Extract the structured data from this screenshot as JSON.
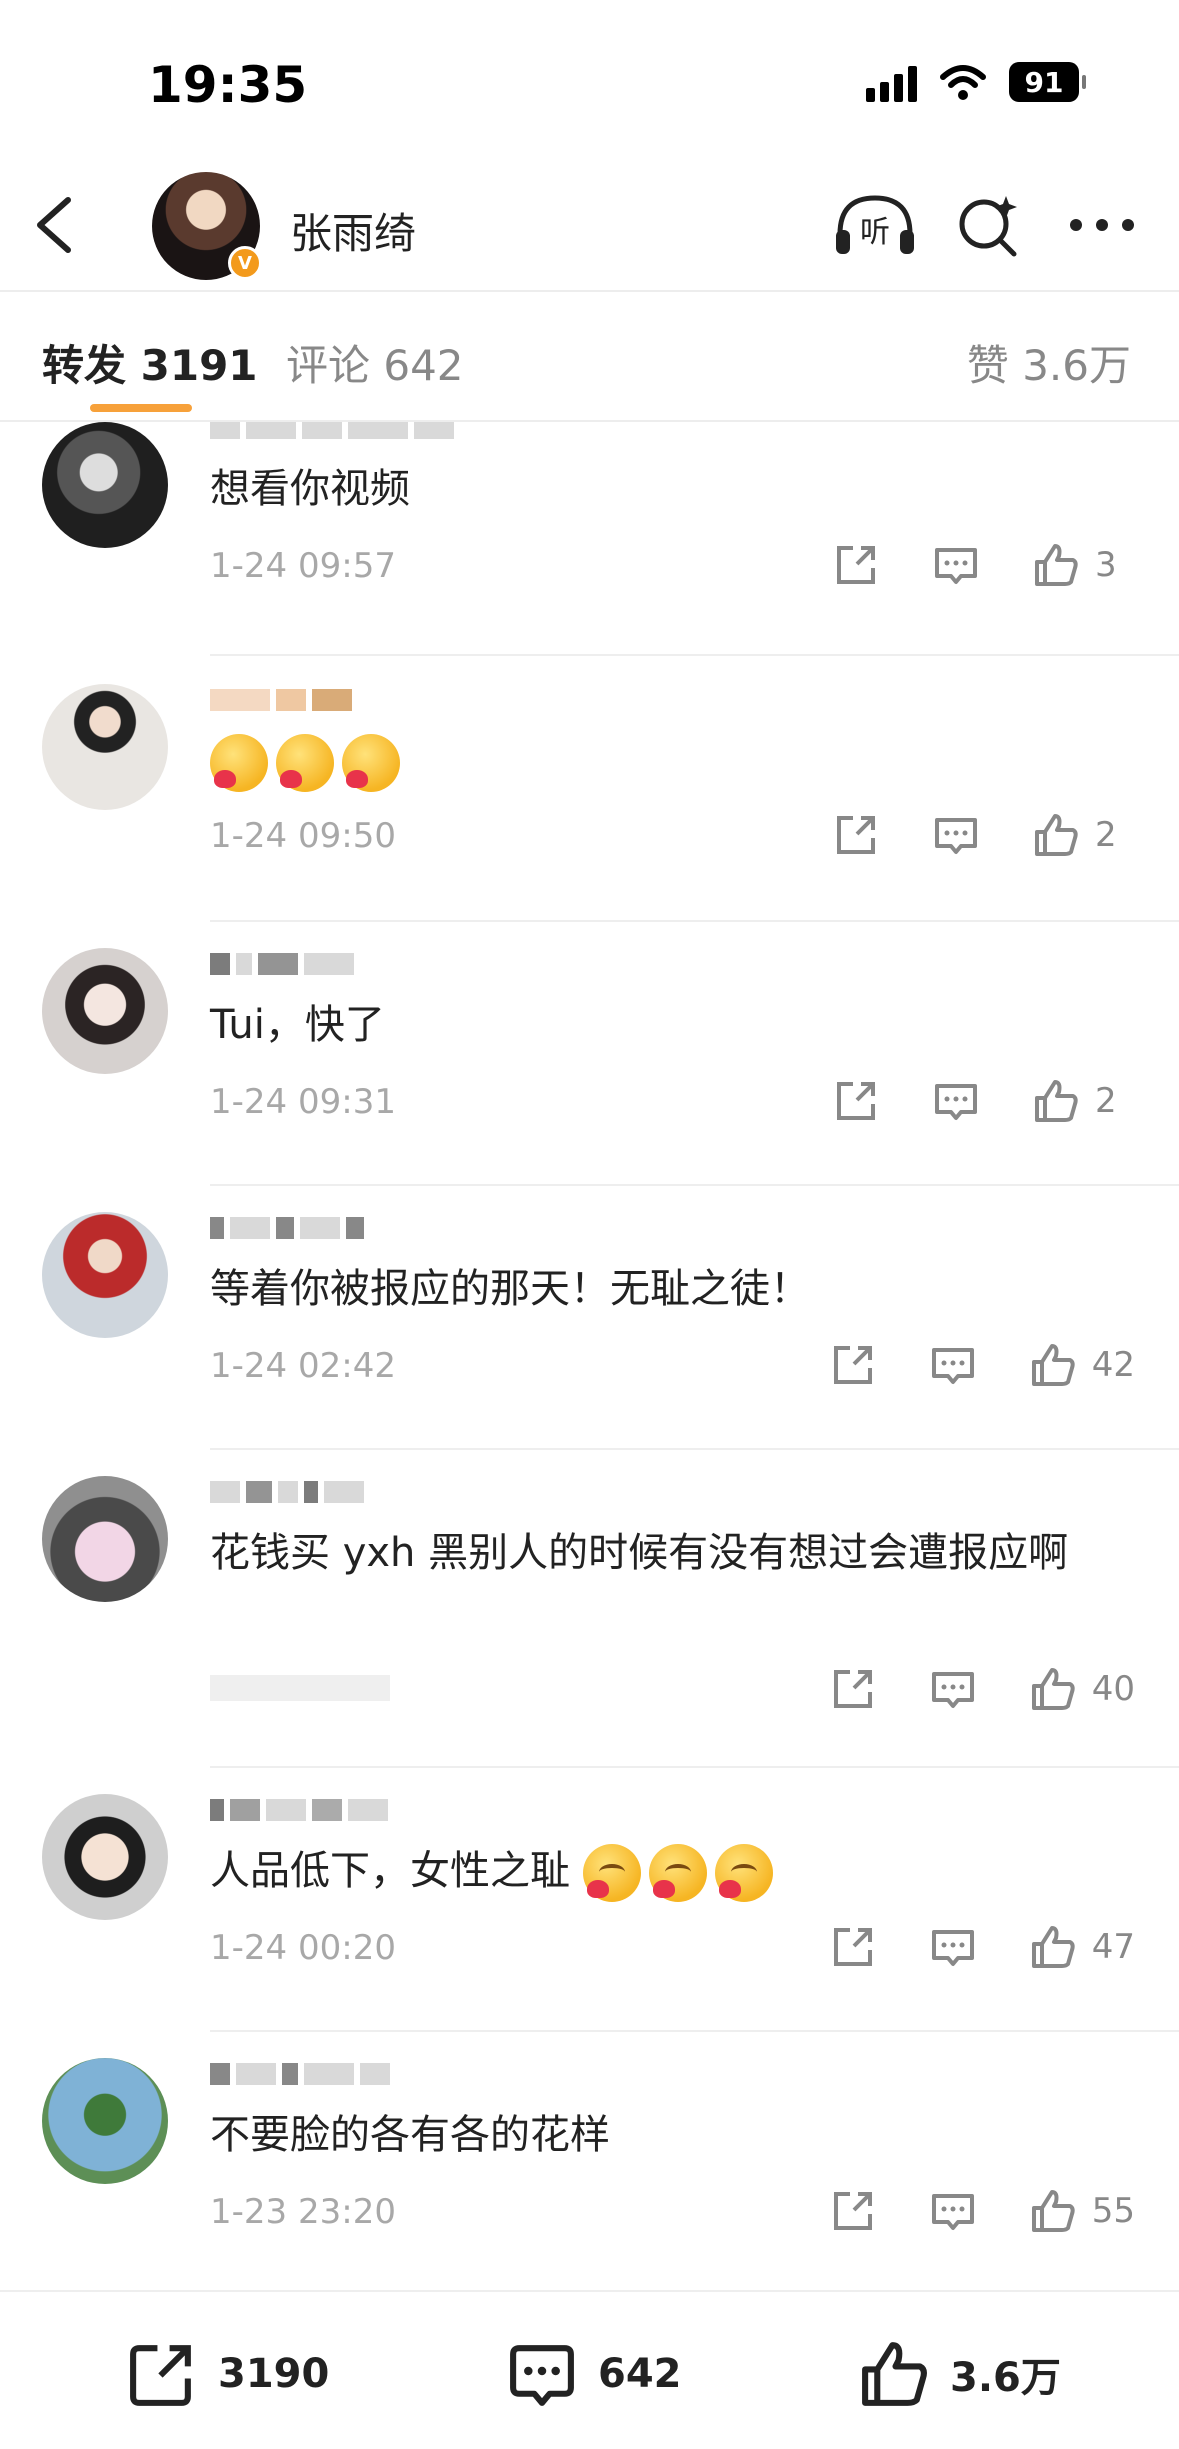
{
  "status_bar": {
    "time": "19:35",
    "battery": "91"
  },
  "header": {
    "name": "张雨绮"
  },
  "tabs": {
    "repost": "转发 3191",
    "comments": "评论 642",
    "likes": "赞 3.6万"
  },
  "comments": [
    {
      "text": "想看你视频",
      "time": "1-24 09:57",
      "likes": "3"
    },
    {
      "text": "",
      "time": "1-24 09:50",
      "likes": "2",
      "emoji_count": 3
    },
    {
      "text": "Tui，快了",
      "time": "1-24 09:31",
      "likes": "2"
    },
    {
      "text": "等着你被报应的那天！无耻之徒！",
      "time": "1-24 02:42",
      "likes": "42"
    },
    {
      "text": "花钱买 yxh 黑别人的时候有没有想过会遭报应啊",
      "time": "",
      "likes": "40"
    },
    {
      "text": "人品低下，女性之耻",
      "time": "1-24 00:20",
      "likes": "47",
      "emoji_count": 3
    },
    {
      "text": "不要脸的各有各的花样",
      "time": "1-23 23:20",
      "likes": "55"
    }
  ],
  "bottom_bar": {
    "reposts": "3190",
    "comments": "642",
    "likes": "3.6万"
  },
  "colors": {
    "accent": "#f7a13a",
    "verified": "#f39a1c",
    "muted_text": "#a8a8a8"
  }
}
